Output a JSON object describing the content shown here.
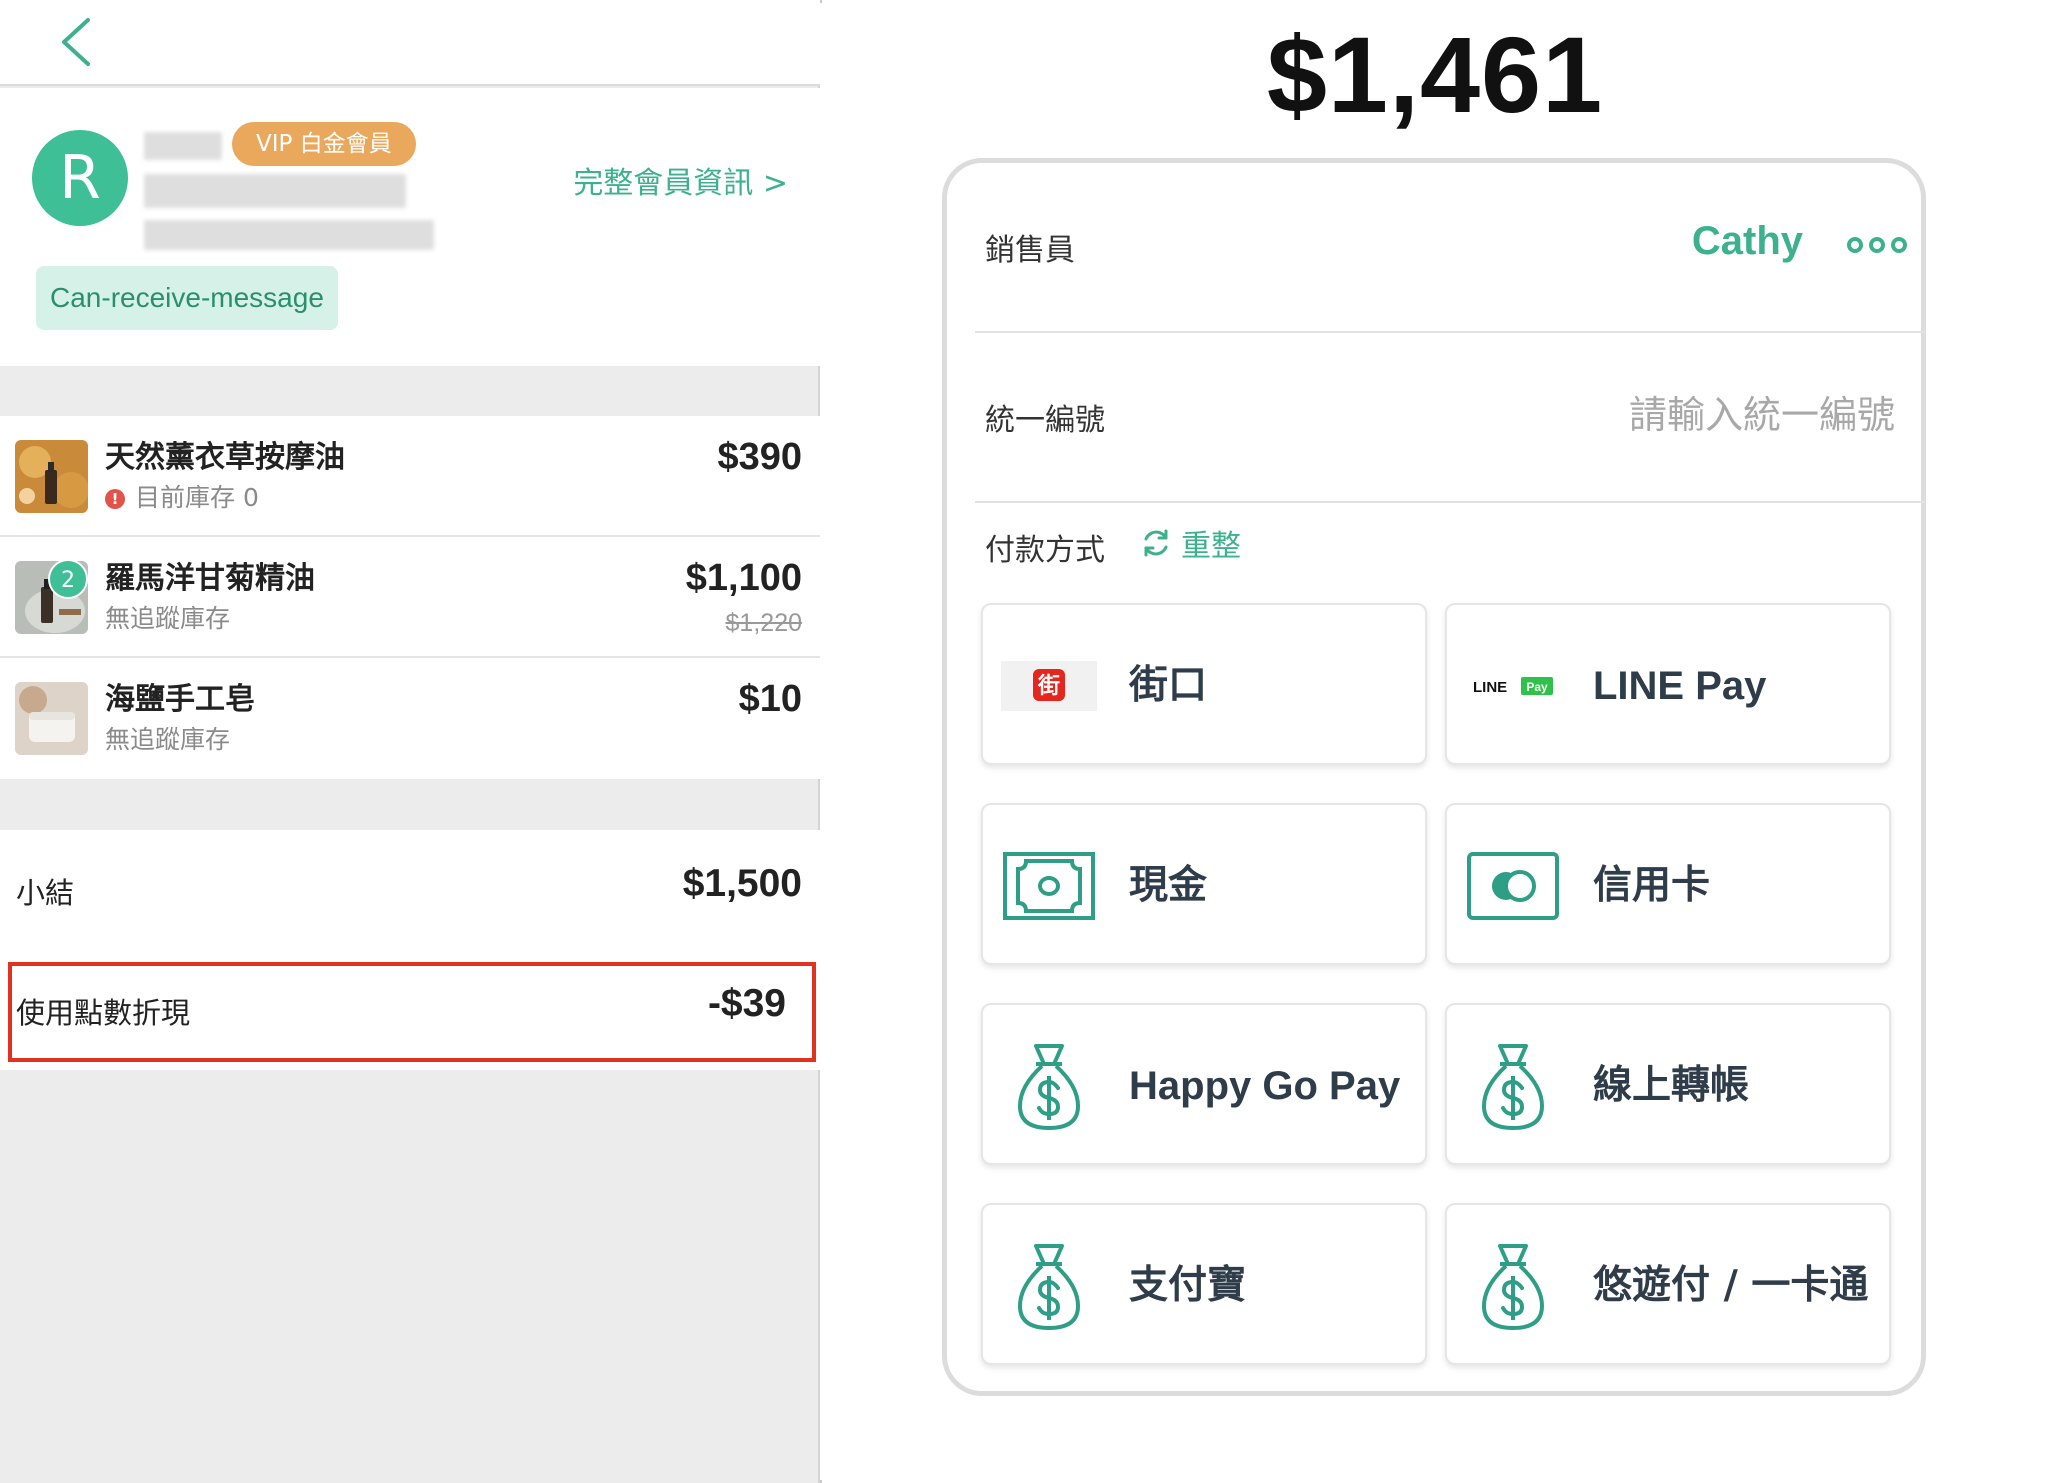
{
  "left_panel": {
    "member": {
      "avatar_letter": "R",
      "vip_badge": "VIP 白金會員",
      "profile_link": "完整會員資訊 >",
      "tag": "Can-receive-message"
    },
    "items": [
      {
        "name": "天然薰衣草按摩油",
        "stock_alert": "!",
        "stock": "目前庫存 0",
        "price": "$390",
        "original_price": ""
      },
      {
        "name": "羅馬洋甘菊精油",
        "quantity_badge": "2",
        "stock": "無追蹤庫存",
        "price": "$1,100",
        "original_price": "$1,220"
      },
      {
        "name": "海鹽手工皂",
        "stock": "無追蹤庫存",
        "price": "$10",
        "original_price": ""
      }
    ],
    "summary": {
      "subtotal_label": "小結",
      "subtotal_value": "$1,500",
      "points_label": "使用點數折現",
      "points_value": "-$39"
    }
  },
  "right_panel": {
    "total": "$1,461",
    "salesperson": {
      "label": "銷售員",
      "value": "Cathy",
      "more_icon": "more-dots-icon"
    },
    "tax_id": {
      "label": "統一編號",
      "placeholder": "請輸入統一編號",
      "value": ""
    },
    "payment": {
      "title": "付款方式",
      "reset_label": "重整",
      "methods": [
        {
          "label": "街口",
          "icon": "jkopay-logo-icon",
          "icon_text": "街"
        },
        {
          "label": "LINE Pay",
          "icon": "line-pay-logo-icon",
          "icon_text_1": "LINE",
          "icon_text_2": "Pay"
        },
        {
          "label": "現金",
          "icon": "cash-icon"
        },
        {
          "label": "信用卡",
          "icon": "credit-card-icon"
        },
        {
          "label": "Happy Go Pay",
          "icon": "money-bag-icon"
        },
        {
          "label": "線上轉帳",
          "icon": "money-bag-icon"
        },
        {
          "label": "支付寶",
          "icon": "money-bag-icon"
        },
        {
          "label": "悠遊付 / 一卡通",
          "icon": "money-bag-icon"
        }
      ]
    }
  },
  "colors": {
    "accent_green": "#3db18d",
    "vip_orange": "#e9a85c",
    "highlight_red": "#e0321e",
    "tag_bg": "#d6f1e7"
  }
}
